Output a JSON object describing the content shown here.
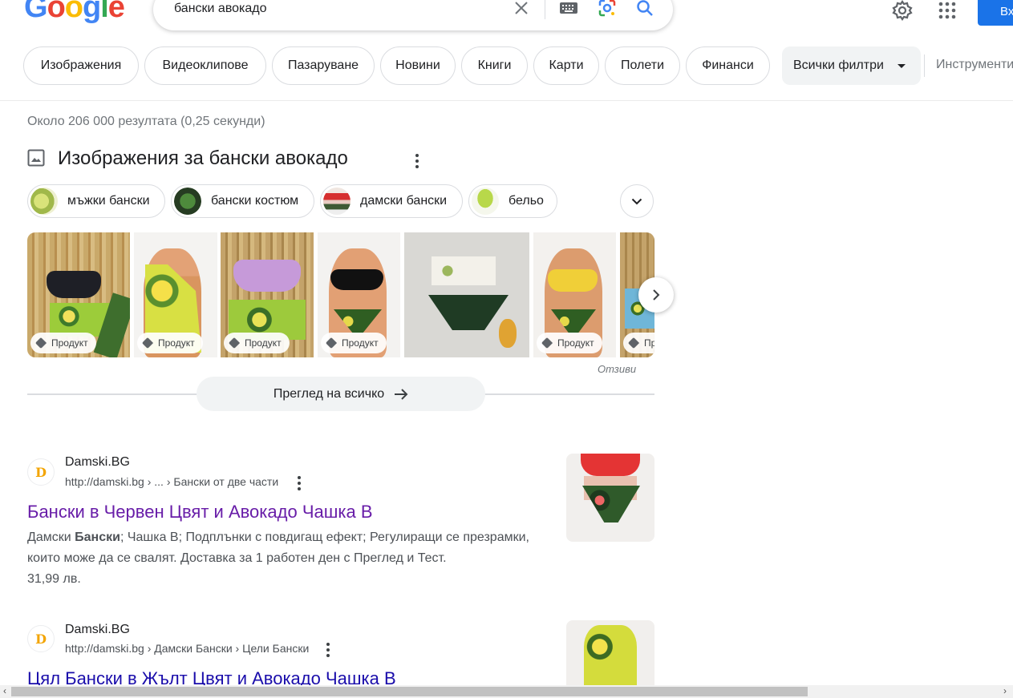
{
  "header": {
    "logo": "Google",
    "search_query": "бански авокадо",
    "signin_label": "Вх"
  },
  "filters": {
    "tabs": [
      "Изображения",
      "Видеоклипове",
      "Пазаруване",
      "Новини",
      "Книги",
      "Карти",
      "Полети",
      "Финанси"
    ],
    "all_filters": "Всички филтри",
    "tools": "Инструменти"
  },
  "result_stats": "Около 206 000 резултата (0,25 секунди)",
  "images": {
    "title": "Изображения за бански авокадо",
    "related": [
      "мъжки бански",
      "бански костюм",
      "дамски бански",
      "бельо"
    ],
    "product_tag": "Продукт",
    "product_tag_cut": "Пр",
    "feedback": "Отзиви",
    "see_all": "Преглед на всичко"
  },
  "results": [
    {
      "site": "Damski.BG",
      "url": "http://damski.bg › ... › Бански от две части",
      "title": "Бански в Червен Цвят и Авокадо Чашка B",
      "snippet_a": "Дамски ",
      "snippet_b": "Бански",
      "snippet_c": "; Чашка B; Подплънки с повдигащ ефект; Регулиращи се презрамки, които може да се свалят. Доставка за 1 работен ден с Преглед и Тест.",
      "price": "31,99 лв."
    },
    {
      "site": "Damski.BG",
      "url": "http://damski.bg › Дамски Бански › Цели Бански",
      "title": "Цял Бански в Жълт Цвят и Авокадо Чашка B"
    }
  ],
  "colors": {
    "visited_link": "#681da8",
    "link": "#1a0dab",
    "accent": "#1a73e8"
  }
}
